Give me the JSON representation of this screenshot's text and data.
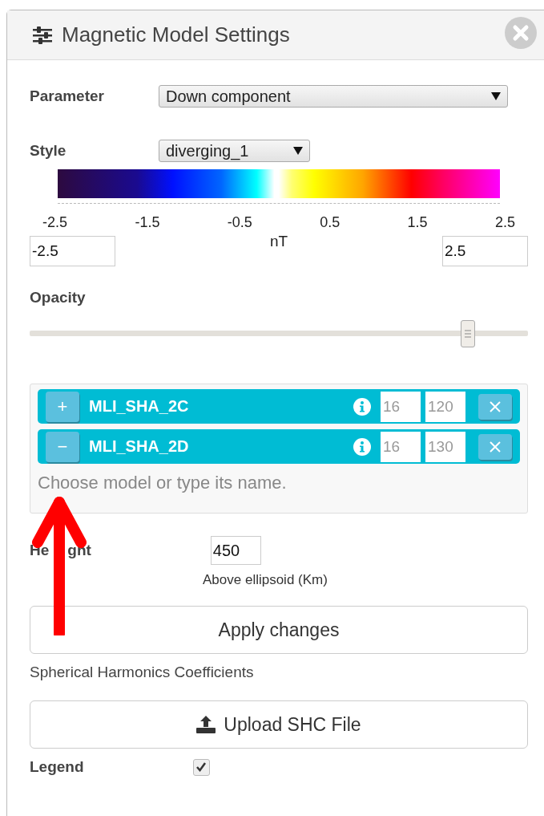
{
  "window": {
    "title": "Magnetic Model Settings"
  },
  "parameter": {
    "label": "Parameter",
    "value": "Down component"
  },
  "style": {
    "label": "Style",
    "value": "diverging_1"
  },
  "colorbar": {
    "ticks": [
      "-2.5",
      "-1.5",
      "-0.5",
      "0.5",
      "1.5",
      "2.5"
    ],
    "unit": "nT",
    "min": "-2.5",
    "max": "2.5"
  },
  "opacity": {
    "label": "Opacity",
    "level": 0.88
  },
  "models": [
    {
      "toggle": "+",
      "name": "MLI_SHA_2C",
      "degree_fields": [
        {
          "placeholder": "16"
        },
        {
          "placeholder": "120"
        }
      ]
    },
    {
      "toggle": "−",
      "name": "MLI_SHA_2D",
      "degree_fields": [
        {
          "placeholder": "16"
        },
        {
          "placeholder": "130"
        }
      ]
    }
  ],
  "model_search": {
    "placeholder": "Choose model or type its name."
  },
  "height": {
    "label_parts": [
      "He",
      "ght"
    ],
    "value": "450",
    "caption": "Above ellipsoid (Km)"
  },
  "apply_button": "Apply changes",
  "shc_label": "Spherical Harmonics Coefficients",
  "upload_button": "Upload SHC File",
  "legend": {
    "label": "Legend",
    "checked": true
  }
}
